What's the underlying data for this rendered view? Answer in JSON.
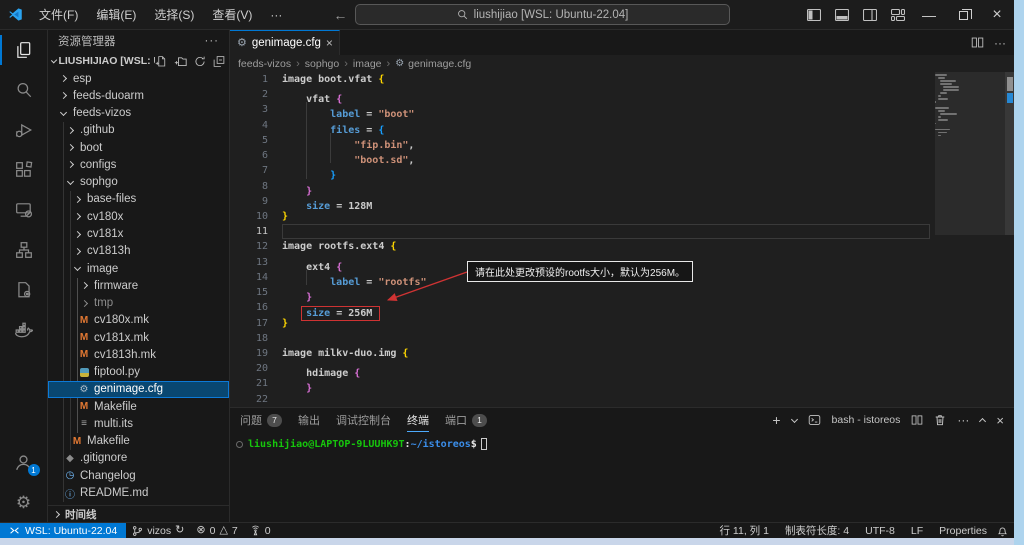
{
  "titlebar": {
    "menus": [
      "文件(F)",
      "编辑(E)",
      "选择(S)",
      "查看(V)",
      "···"
    ],
    "command_center": "liushijiao [WSL: Ubuntu-22.04]"
  },
  "activity": {
    "account_badge": "1"
  },
  "sidebar": {
    "title": "资源管理器",
    "section": "LIUSHIJIAO [WSL: U...",
    "timeline": "时间线",
    "tree": [
      {
        "label": "esp",
        "level": 0,
        "kind": "folder"
      },
      {
        "label": "feeds-duoarm",
        "level": 0,
        "kind": "folder"
      },
      {
        "label": "feeds-vizos",
        "level": 0,
        "kind": "folder",
        "expanded": true
      },
      {
        "label": ".github",
        "level": 1,
        "kind": "folder"
      },
      {
        "label": "boot",
        "level": 1,
        "kind": "folder"
      },
      {
        "label": "configs",
        "level": 1,
        "kind": "folder"
      },
      {
        "label": "sophgo",
        "level": 1,
        "kind": "folder",
        "expanded": true
      },
      {
        "label": "base-files",
        "level": 2,
        "kind": "folder"
      },
      {
        "label": "cv180x",
        "level": 2,
        "kind": "folder"
      },
      {
        "label": "cv181x",
        "level": 2,
        "kind": "folder"
      },
      {
        "label": "cv1813h",
        "level": 2,
        "kind": "folder"
      },
      {
        "label": "image",
        "level": 2,
        "kind": "folder",
        "expanded": true
      },
      {
        "label": "firmware",
        "level": 3,
        "kind": "folder"
      },
      {
        "label": "tmp",
        "level": 3,
        "kind": "folder",
        "dim": true
      },
      {
        "label": "cv180x.mk",
        "level": 3,
        "kind": "file",
        "icon": "makefile-icon"
      },
      {
        "label": "cv181x.mk",
        "level": 3,
        "kind": "file",
        "icon": "makefile-icon"
      },
      {
        "label": "cv1813h.mk",
        "level": 3,
        "kind": "file",
        "icon": "makefile-icon"
      },
      {
        "label": "fiptool.py",
        "level": 3,
        "kind": "file",
        "icon": "python-icon"
      },
      {
        "label": "genimage.cfg",
        "level": 3,
        "kind": "file",
        "icon": "gear-icon",
        "selected": true
      },
      {
        "label": "Makefile",
        "level": 3,
        "kind": "file",
        "icon": "makefile-icon"
      },
      {
        "label": "multi.its",
        "level": 3,
        "kind": "file",
        "icon": "list-icon"
      },
      {
        "label": "Makefile",
        "level": 2,
        "kind": "file",
        "icon": "makefile-icon"
      },
      {
        "label": ".gitignore",
        "level": 1,
        "kind": "file",
        "icon": "git-icon"
      },
      {
        "label": "Changelog",
        "level": 1,
        "kind": "file",
        "icon": "clock-icon"
      },
      {
        "label": "README.md",
        "level": 1,
        "kind": "file",
        "icon": "info-icon"
      }
    ]
  },
  "editor": {
    "tab_label": "genimage.cfg",
    "breadcrumbs": [
      "feeds-vizos",
      "sophgo",
      "image",
      "genimage.cfg"
    ],
    "annotation": "请在此处更改预设的rootfs大小，默认为256M。",
    "current_line": 11,
    "lines": [
      {
        "n": 1,
        "ind": 0,
        "seg": [
          [
            "image boot.vfat ",
            "pln"
          ],
          [
            "{",
            "b1"
          ]
        ]
      },
      {
        "n": 2,
        "ind": 1,
        "seg": [
          [
            "vfat ",
            "pln"
          ],
          [
            "{",
            "b2"
          ]
        ]
      },
      {
        "n": 3,
        "ind": 2,
        "seg": [
          [
            "label",
            "key"
          ],
          [
            " = ",
            "pln"
          ],
          [
            "\"boot\"",
            "str"
          ]
        ]
      },
      {
        "n": 4,
        "ind": 2,
        "seg": [
          [
            "files",
            "key"
          ],
          [
            " = ",
            "pln"
          ],
          [
            "{",
            "b3"
          ]
        ]
      },
      {
        "n": 5,
        "ind": 3,
        "seg": [
          [
            "\"fip.bin\"",
            "str"
          ],
          [
            ",",
            "pln"
          ]
        ]
      },
      {
        "n": 6,
        "ind": 3,
        "seg": [
          [
            "\"boot.sd\"",
            "str"
          ],
          [
            ",",
            "pln"
          ]
        ]
      },
      {
        "n": 7,
        "ind": 2,
        "seg": [
          [
            "}",
            "b3"
          ]
        ]
      },
      {
        "n": 8,
        "ind": 1,
        "seg": [
          [
            "}",
            "b2"
          ]
        ]
      },
      {
        "n": 9,
        "ind": 1,
        "seg": [
          [
            "size",
            "key"
          ],
          [
            " = ",
            "pln"
          ],
          [
            "128M",
            "pln"
          ]
        ]
      },
      {
        "n": 10,
        "ind": 0,
        "seg": [
          [
            "}",
            "b1"
          ]
        ]
      },
      {
        "n": 11,
        "ind": 0,
        "seg": [],
        "current": true
      },
      {
        "n": 12,
        "ind": 0,
        "seg": [
          [
            "image rootfs.ext4 ",
            "pln"
          ],
          [
            "{",
            "b1"
          ]
        ]
      },
      {
        "n": 13,
        "ind": 1,
        "seg": [
          [
            "ext4 ",
            "pln"
          ],
          [
            "{",
            "b2"
          ]
        ]
      },
      {
        "n": 14,
        "ind": 2,
        "seg": [
          [
            "label",
            "key"
          ],
          [
            " = ",
            "pln"
          ],
          [
            "\"rootfs\"",
            "str"
          ]
        ]
      },
      {
        "n": 15,
        "ind": 1,
        "seg": [
          [
            "}",
            "b2"
          ]
        ]
      },
      {
        "n": 16,
        "ind": 1,
        "seg": [
          [
            "size",
            "key"
          ],
          [
            " = ",
            "pln"
          ],
          [
            "256M",
            "pln"
          ]
        ],
        "redbox": true
      },
      {
        "n": 17,
        "ind": 0,
        "seg": [
          [
            "}",
            "b1"
          ]
        ]
      },
      {
        "n": 18,
        "ind": 0,
        "seg": []
      },
      {
        "n": 19,
        "ind": 0,
        "seg": [
          [
            "image milkv-duo.img ",
            "pln"
          ],
          [
            "{",
            "b1"
          ]
        ]
      },
      {
        "n": 20,
        "ind": 1,
        "seg": [
          [
            "hdimage ",
            "pln"
          ],
          [
            "{",
            "b2"
          ]
        ]
      },
      {
        "n": 21,
        "ind": 1,
        "seg": [
          [
            "}",
            "b2"
          ]
        ]
      },
      {
        "n": 22,
        "ind": 0,
        "seg": []
      }
    ]
  },
  "panel": {
    "tabs": [
      {
        "label": "问题",
        "badge": "7"
      },
      {
        "label": "输出"
      },
      {
        "label": "调试控制台"
      },
      {
        "label": "终端",
        "active": true
      },
      {
        "label": "端口",
        "badge": "1"
      }
    ],
    "terminal_title": "bash - istoreos",
    "prompt": {
      "user": "liushijiao@LAPTOP-9LUUHK9T",
      "colon": ":",
      "path": "~/istoreos",
      "dollar": "$"
    }
  },
  "status": {
    "remote": "WSL: Ubuntu-22.04",
    "branch": "vizos",
    "errors": "0",
    "warnings": "7",
    "ports": "0",
    "line_col": "行 11, 列 1",
    "tab_size": "制表符长度: 4",
    "encoding": "UTF-8",
    "eol": "LF",
    "language": "Properties"
  },
  "colors": {
    "accent": "#0078d4",
    "selection_bg": "#094771",
    "annotation_red": "#cf3333",
    "terminal_green": "#16c60c",
    "terminal_path_blue": "#3b8eea",
    "makefile_orange": "#e37933",
    "python_blue": "#519aba",
    "bracket_gold": "#ffd700",
    "bracket_pink": "#da70d6",
    "bracket_blue": "#179fff",
    "keyword_blue": "#569cd6",
    "string_orange": "#ce9178"
  }
}
